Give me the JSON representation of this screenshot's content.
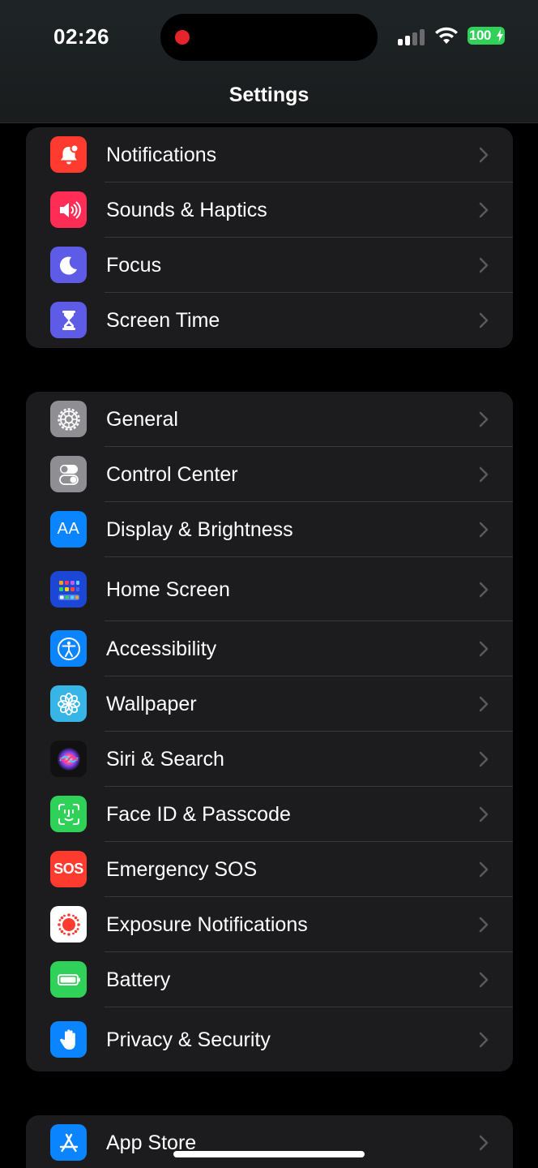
{
  "status_bar": {
    "time": "02:26",
    "battery": "100"
  },
  "header": {
    "title": "Settings"
  },
  "groups": [
    {
      "items": [
        {
          "label": "Notifications",
          "icon": "bell-badge-icon",
          "color": "#ff3b30"
        },
        {
          "label": "Sounds & Haptics",
          "icon": "speaker-wave-icon",
          "color": "#ff2d55"
        },
        {
          "label": "Focus",
          "icon": "moon-icon",
          "color": "#5e5ce6"
        },
        {
          "label": "Screen Time",
          "icon": "hourglass-icon",
          "color": "#5e5ce6"
        }
      ]
    },
    {
      "items": [
        {
          "label": "General",
          "icon": "gear-icon",
          "color": "#8e8e93"
        },
        {
          "label": "Control Center",
          "icon": "toggles-icon",
          "color": "#8e8e93"
        },
        {
          "label": "Display & Brightness",
          "icon": "text-size-icon",
          "color": "#0a84ff"
        },
        {
          "label": "Home Screen",
          "icon": "app-grid-icon",
          "color": "#1c47d6"
        },
        {
          "label": "Accessibility",
          "icon": "accessibility-icon",
          "color": "#0a84ff"
        },
        {
          "label": "Wallpaper",
          "icon": "flower-icon",
          "color": "#36b5e6"
        },
        {
          "label": "Siri & Search",
          "icon": "siri-icon",
          "color": "#111111"
        },
        {
          "label": "Face ID & Passcode",
          "icon": "face-id-icon",
          "color": "#30d158"
        },
        {
          "label": "Emergency SOS",
          "icon": "sos-icon",
          "color": "#ff3b30"
        },
        {
          "label": "Exposure Notifications",
          "icon": "exposure-icon",
          "color": "#ffffff"
        },
        {
          "label": "Battery",
          "icon": "battery-icon",
          "color": "#30d158"
        },
        {
          "label": "Privacy & Security",
          "icon": "hand-icon",
          "color": "#0a84ff"
        }
      ]
    },
    {
      "items": [
        {
          "label": "App Store",
          "icon": "app-store-icon",
          "color": "#0a84ff"
        }
      ]
    }
  ],
  "sos_text": "SOS",
  "display_icon_text": "AA"
}
